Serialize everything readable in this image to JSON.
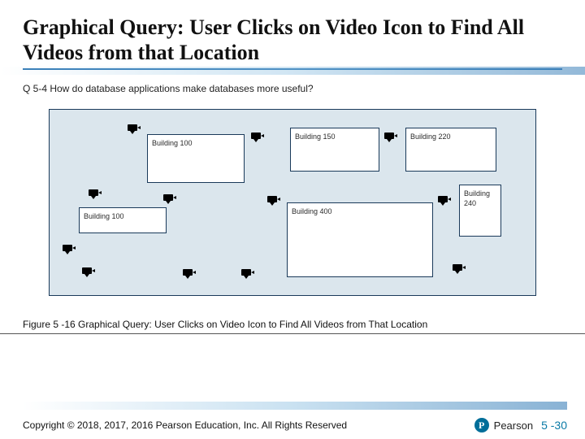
{
  "title": "Graphical Query: User Clicks on Video Icon to Find All Videos from that Location",
  "subquestion": "Q 5-4 How do database applications make databases more useful?",
  "figure": {
    "buildings": {
      "b100a": "Building 100",
      "b150": "Building 150",
      "b220": "Building 220",
      "b100b": "Building 100",
      "b240_line1": "Building",
      "b240_line2": "240",
      "b400": "Building 400"
    }
  },
  "caption": "Figure 5 -16 Graphical Query: User Clicks on Video Icon to Find All Videos from That Location",
  "footer": {
    "copyright": "Copyright © 2018, 2017, 2016 Pearson Education, Inc. All Rights Reserved",
    "brand_initial": "P",
    "brand": "Pearson",
    "page": "5 -30"
  }
}
